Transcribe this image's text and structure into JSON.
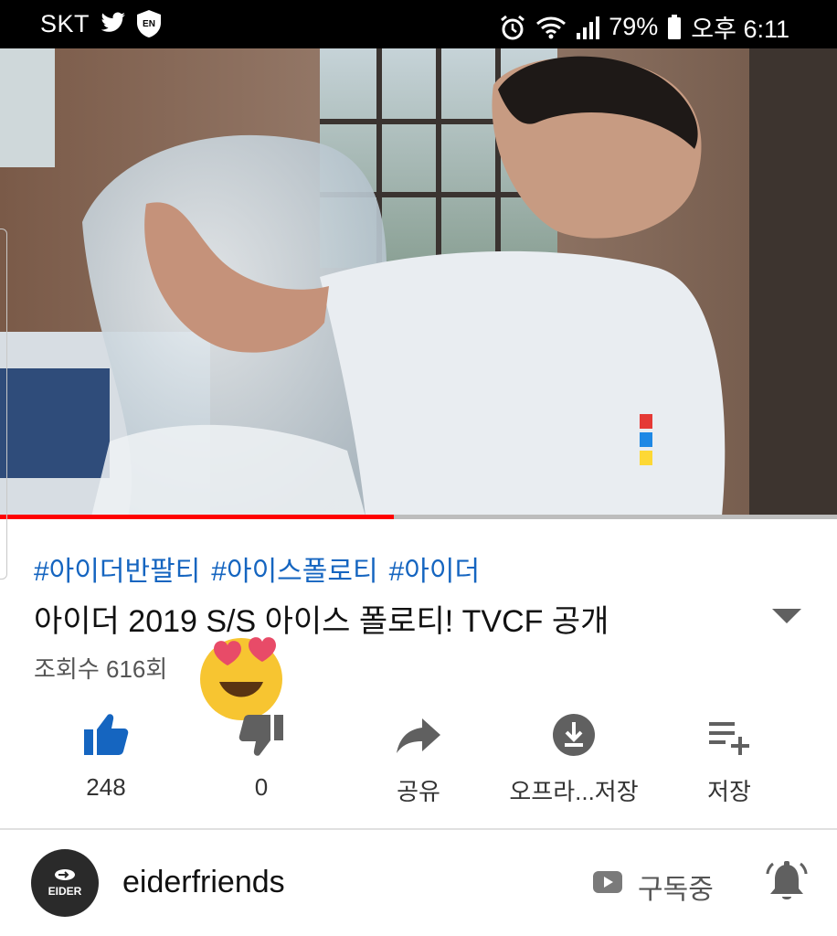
{
  "status_bar": {
    "carrier": "SKT",
    "battery": "79%",
    "time": "오후 6:11",
    "icons": [
      "twitter-icon",
      "shield-en-icon",
      "alarm-icon",
      "wifi-icon",
      "signal-icon",
      "battery-icon"
    ]
  },
  "video": {
    "progress": 0.47,
    "progress_color": "#ff0000"
  },
  "meta": {
    "hashtags": [
      "#아이더반팔티",
      "#아이스폴로티",
      "#아이더"
    ],
    "title": "아이더 2019 S/S 아이스 폴로티! TVCF 공개",
    "views": "조회수 616회",
    "hashtag_color": "#1565c0"
  },
  "actions": {
    "like": {
      "label": "248",
      "icon": "thumbs-up-icon",
      "color": "#1565c0"
    },
    "dislike": {
      "label": "0",
      "icon": "thumbs-down-icon"
    },
    "share": {
      "label": "공유",
      "icon": "share-icon"
    },
    "download": {
      "label": "오프라...저장",
      "icon": "download-icon"
    },
    "save": {
      "label": "저장",
      "icon": "playlist-add-icon"
    }
  },
  "channel": {
    "name": "eiderfriends",
    "avatar_text": "EIDER",
    "subscribe_label": "구독중"
  }
}
